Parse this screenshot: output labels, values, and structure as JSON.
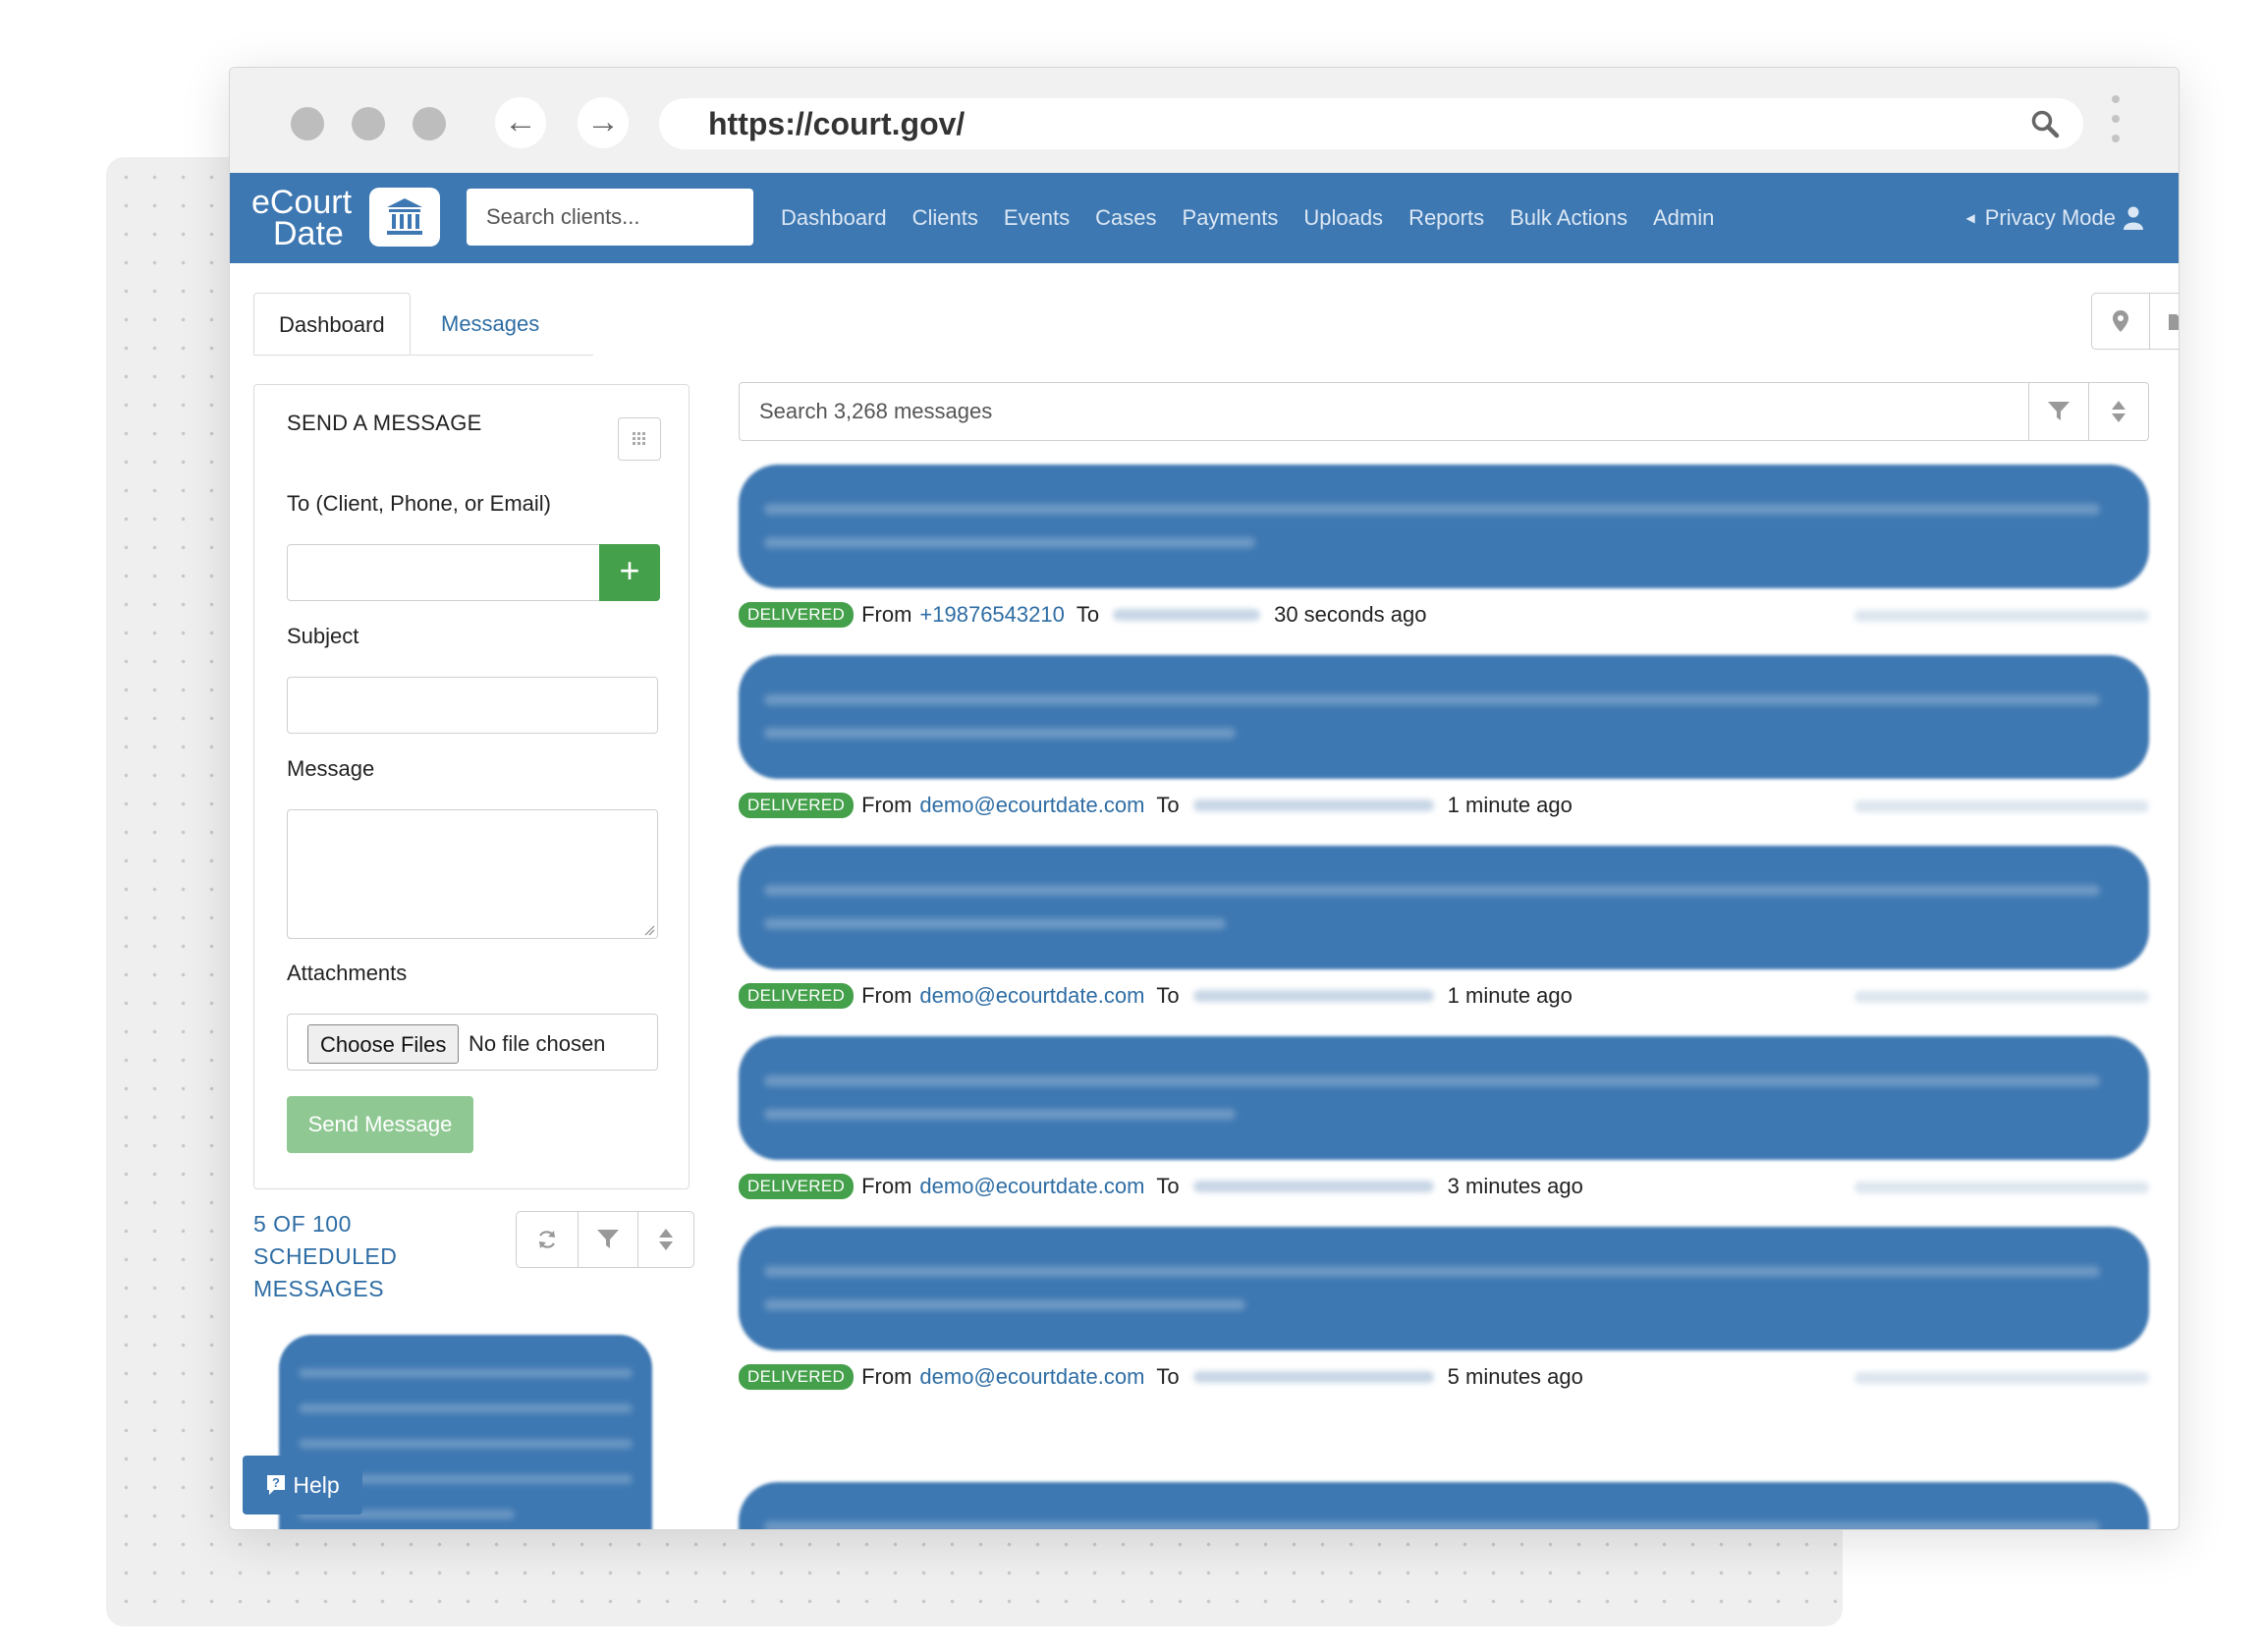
{
  "browser": {
    "url": "https://court.gov/"
  },
  "app": {
    "logo_line1": "eCourt",
    "logo_line2": "Date",
    "search_placeholder": "Search clients...",
    "nav": [
      "Dashboard",
      "Clients",
      "Events",
      "Cases",
      "Payments",
      "Uploads",
      "Reports",
      "Bulk Actions",
      "Admin"
    ],
    "privacy_mode": "Privacy Mode"
  },
  "tabs": {
    "dashboard": "Dashboard",
    "messages": "Messages"
  },
  "send_panel": {
    "title": "SEND A MESSAGE",
    "to_label": "To (Client, Phone, or Email)",
    "subject_label": "Subject",
    "message_label": "Message",
    "attachments_label": "Attachments",
    "choose_files": "Choose Files",
    "no_file": "No file chosen",
    "send_button": "Send Message"
  },
  "scheduled": {
    "label": "5 OF 100 SCHEDULED MESSAGES"
  },
  "help": {
    "label": "Help"
  },
  "messages": {
    "search_placeholder": "Search 3,268 messages",
    "items": [
      {
        "status": "DELIVERED",
        "from_label": "From",
        "sender": "+19876543210",
        "to_label": "To",
        "time": "30 seconds ago"
      },
      {
        "status": "DELIVERED",
        "from_label": "From",
        "sender": "demo@ecourtdate.com",
        "to_label": "To",
        "time": "1 minute ago"
      },
      {
        "status": "DELIVERED",
        "from_label": "From",
        "sender": "demo@ecourtdate.com",
        "to_label": "To",
        "time": "1 minute ago"
      },
      {
        "status": "DELIVERED",
        "from_label": "From",
        "sender": "demo@ecourtdate.com",
        "to_label": "To",
        "time": "3 minutes ago"
      },
      {
        "status": "DELIVERED",
        "from_label": "From",
        "sender": "demo@ecourtdate.com",
        "to_label": "To",
        "time": "5 minutes ago"
      }
    ]
  },
  "colors": {
    "primary": "#3e78b2",
    "success": "#44a04a",
    "link": "#2e6da4"
  }
}
